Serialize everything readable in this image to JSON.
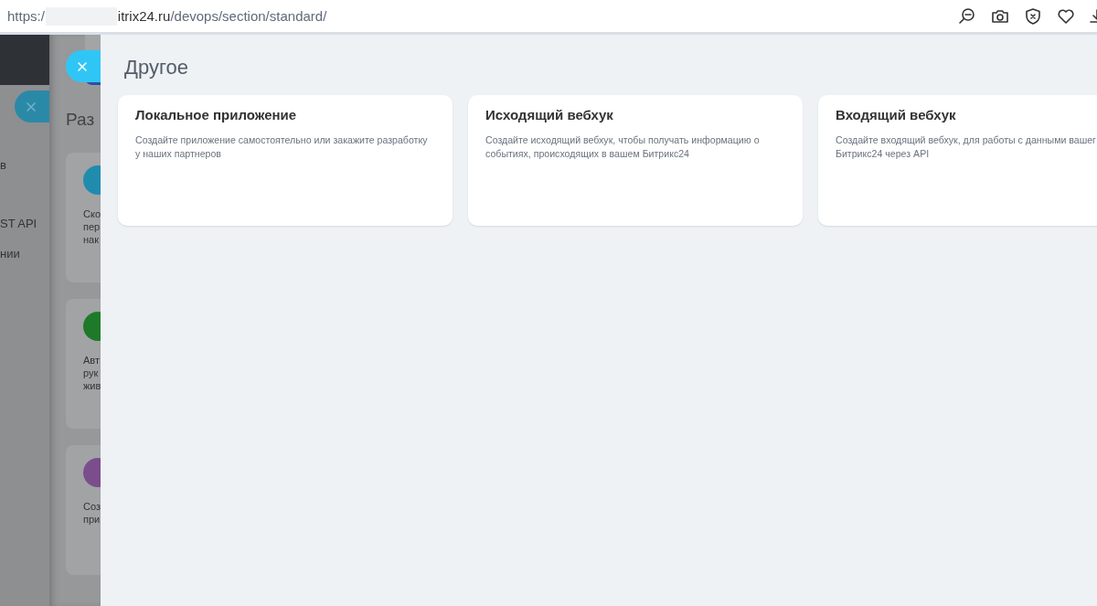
{
  "address_bar": {
    "scheme": "https:/",
    "host": "itrix24.ru",
    "path": "/devops/section/standard/"
  },
  "back_panel": {
    "items": [
      "в",
      "ST API",
      "нии"
    ]
  },
  "middle_panel": {
    "heading": "Раз",
    "cards": [
      {
        "color": "#1f8cae",
        "lines": [
          "Ско",
          "пер",
          "нак"
        ]
      },
      {
        "color": "#1e7a2a",
        "lines": [
          "Авт",
          "рук",
          "жив"
        ]
      },
      {
        "color": "#7a4e8c",
        "lines": [
          "Соз",
          "при"
        ]
      }
    ]
  },
  "slider": {
    "title": "Другое",
    "cards": [
      {
        "title": "Локальное приложение",
        "lines": [
          "Создайте приложение самостоятельно или закажите разработку",
          "у наших партнеров"
        ]
      },
      {
        "title": "Исходящий вебхук",
        "lines": [
          "Создайте исходящий вебхук, чтобы получать информацию о",
          "событиях, происходящих в вашем Битрикс24"
        ]
      },
      {
        "title": "Входящий вебхук",
        "lines": [
          "Создайте входящий вебхук, для работы с данными вашег",
          "Битрикс24 через API"
        ]
      }
    ]
  }
}
